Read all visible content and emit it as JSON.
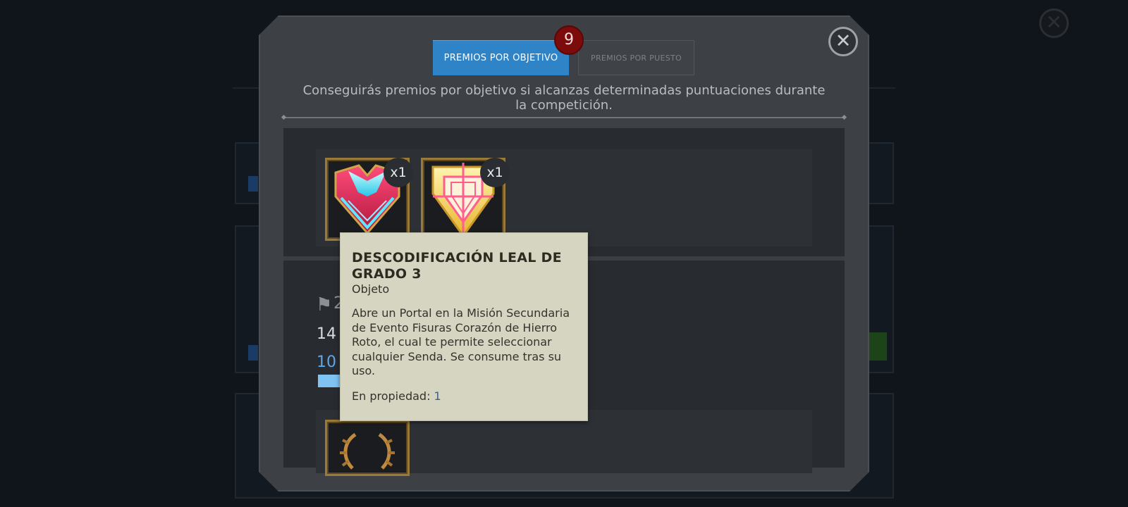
{
  "background": {
    "close_label": "✕"
  },
  "modal": {
    "close_label": "✕",
    "tabs": [
      {
        "label": "PREMIOS POR OBJETIVO",
        "active": true
      },
      {
        "label": "PREMIOS POR PUESTO",
        "active": false
      }
    ],
    "badge_count": "9",
    "description": "Conseguirás premios por objetivo si alcanzas determinadas puntuaciones durante la competición.",
    "rewards_row_1": [
      {
        "icon": "heart-crystal-icon",
        "quantity": "x1"
      },
      {
        "icon": "loyal-shield-icon",
        "quantity": "x1"
      }
    ],
    "milestone": {
      "number": "2",
      "score": "14",
      "points": "10"
    },
    "rewards_row_2": [
      {
        "icon": "laurel-wreath-icon"
      }
    ]
  },
  "tooltip": {
    "title": "DESCODIFICACIÓN LEAL DE GRADO 3",
    "type": "Objeto",
    "description": "Abre un Portal en la Misión Secundaria de Evento Fisuras Corazón de Hierro Roto, el cual te permite seleccionar cualquier Senda. Se consume tras su uso.",
    "owned_label": "En propiedad: ",
    "owned_value": "1"
  },
  "colors": {
    "active_tab": "#2f84c8",
    "badge": "#7c0b0b",
    "tooltip_bg": "#d6d5c2",
    "item_border": "#9a7a3a",
    "accent_blue": "#5ea7e8"
  }
}
